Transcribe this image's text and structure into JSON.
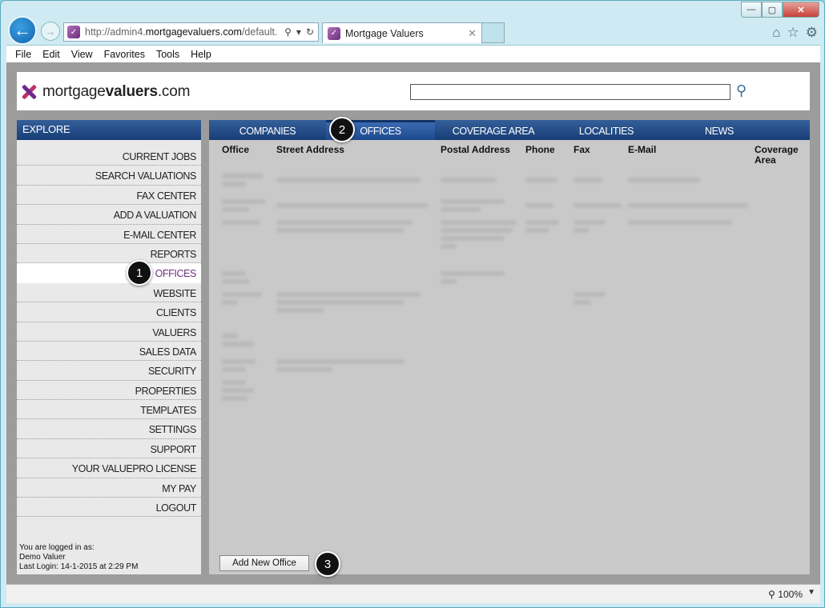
{
  "browser": {
    "window_buttons": {
      "minimize": "—",
      "maximize": "▢",
      "close": "✕"
    },
    "address_prefix": "http://admin4.",
    "address_domain": "mortgagevaluers.com",
    "address_suffix": "/default.",
    "tab_title": "Mortgage Valuers",
    "tab_close": "✕",
    "zoom": "100%"
  },
  "menu": [
    "File",
    "Edit",
    "View",
    "Favorites",
    "Tools",
    "Help"
  ],
  "site": {
    "logo_plain": "mortgage",
    "logo_bold": "valuers",
    "logo_tail": ".com",
    "search_value": ""
  },
  "explore": {
    "title": "EXPLORE",
    "items": [
      "CURRENT JOBS",
      "SEARCH VALUATIONS",
      "FAX CENTER",
      "ADD A VALUATION",
      "E-MAIL CENTER",
      "REPORTS",
      "OFFICES",
      "WEBSITE",
      "CLIENTS",
      "VALUERS",
      "SALES DATA",
      "SECURITY",
      "PROPERTIES",
      "TEMPLATES",
      "SETTINGS",
      "SUPPORT",
      "YOUR VALUEPRO LICENSE",
      "MY PAY",
      "LOGOUT"
    ],
    "active_item": "OFFICES",
    "login_line1": "You are logged in as:",
    "login_user": "Demo Valuer",
    "login_last": "Last Login: 14-1-2015 at 2:29 PM"
  },
  "tabs": [
    "COMPANIES",
    "OFFICES",
    "COVERAGE AREA",
    "LOCALITIES",
    "NEWS"
  ],
  "active_tab": "OFFICES",
  "table": {
    "columns": [
      "Office",
      "Street Address",
      "Postal Address",
      "Phone",
      "Fax",
      "E-Mail",
      "Coverage Area"
    ]
  },
  "add_button": "Add New Office",
  "callouts": [
    "1",
    "2",
    "3"
  ]
}
